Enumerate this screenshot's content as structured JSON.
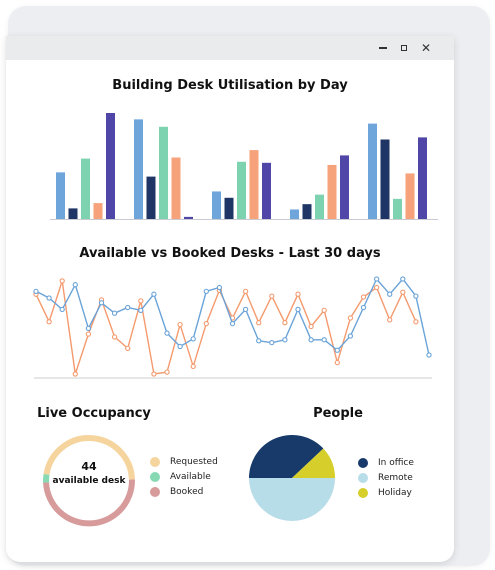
{
  "window": {
    "controls": {
      "minimize_icon": "minimize-icon",
      "maximize_icon": "maximize-icon",
      "close_icon": "close-icon"
    }
  },
  "colors": {
    "series": [
      "#6ea6dc",
      "#1e3566",
      "#7dd2b0",
      "#f6a27a",
      "#4f46a8"
    ],
    "line_available": "#6aa3d8",
    "line_booked": "#f49a6e",
    "requested": "#f5d49e",
    "available": "#86d9b3",
    "booked": "#d79b9b",
    "in_office": "#173a6a",
    "remote": "#b7dde9",
    "holiday": "#d6cf2b"
  },
  "chart_data": [
    {
      "type": "bar",
      "title": "Building Desk Utilisation by Day",
      "groups": 5,
      "series_per_group": 5,
      "ylim": [
        0,
        100
      ],
      "series": [
        {
          "values": [
            44,
            94,
            26,
            9,
            90
          ]
        },
        {
          "values": [
            10,
            40,
            20,
            14,
            75
          ]
        },
        {
          "values": [
            57,
            87,
            54,
            23,
            19
          ]
        },
        {
          "values": [
            15,
            58,
            65,
            51,
            43
          ]
        },
        {
          "values": [
            100,
            2,
            53,
            60,
            77
          ]
        }
      ]
    },
    {
      "type": "line",
      "title": "Available vs Booked Desks - Last 30 days",
      "x": [
        1,
        2,
        3,
        4,
        5,
        6,
        7,
        8,
        9,
        10,
        11,
        12,
        13,
        14,
        15,
        16,
        17,
        18,
        19,
        20,
        21,
        22,
        23,
        24,
        25,
        26,
        27,
        28,
        29,
        30,
        31
      ],
      "ylim": [
        0,
        100
      ],
      "series": [
        {
          "values": [
            87,
            80,
            68,
            94,
            48,
            75,
            64,
            70,
            67,
            84,
            43,
            29,
            37,
            87,
            91,
            53,
            68,
            35,
            33,
            36,
            68,
            36,
            36,
            25,
            40,
            70,
            100,
            84,
            100,
            82,
            20
          ]
        },
        {
          "values": [
            84,
            55,
            98,
            0,
            42,
            78,
            39,
            27,
            77,
            0,
            2,
            52,
            8,
            53,
            88,
            59,
            87,
            54,
            82,
            54,
            84,
            50,
            67,
            12,
            59,
            81,
            91,
            57,
            86,
            55
          ]
        }
      ]
    },
    {
      "type": "pie",
      "title": "Live Occupancy",
      "variant": "donut",
      "center_value": "44",
      "center_label": "available desk",
      "labels": [
        "Requested",
        "Available",
        "Booked"
      ],
      "values": [
        47,
        3,
        50
      ]
    },
    {
      "type": "pie",
      "title": "People",
      "labels": [
        "In office",
        "Remote",
        "Holiday"
      ],
      "values": [
        38,
        50,
        12
      ]
    }
  ],
  "occupancy_legend": {
    "items": [
      {
        "label": "Requested"
      },
      {
        "label": "Available"
      },
      {
        "label": "Booked"
      }
    ]
  },
  "people_legend": {
    "items": [
      {
        "label": "In office"
      },
      {
        "label": "Remote"
      },
      {
        "label": "Holiday"
      }
    ]
  }
}
